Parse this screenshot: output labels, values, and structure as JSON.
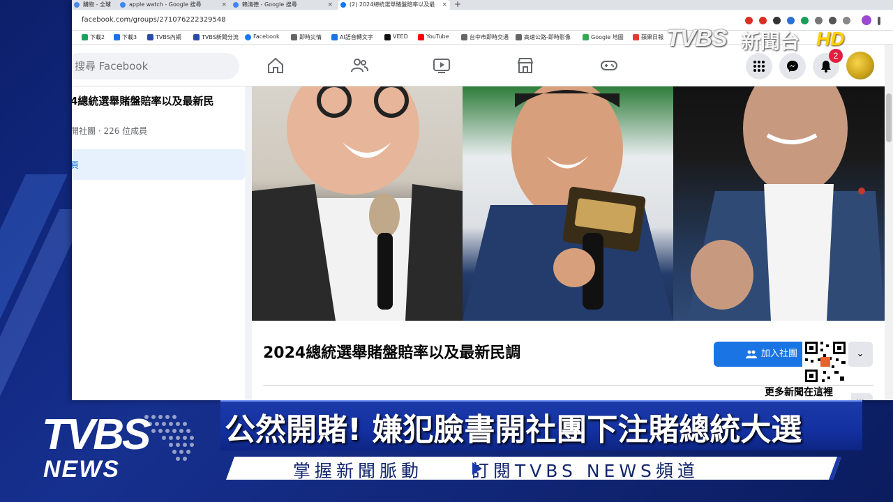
{
  "browser": {
    "tabs": [
      {
        "label": "購物 - 全球",
        "favicon_color": "#4a86e8"
      },
      {
        "label": "apple watch - Google 搜尋",
        "favicon_color": "#4285f4"
      },
      {
        "label": "賴清德 - Google 搜尋",
        "favicon_color": "#4285f4"
      },
      {
        "label": "(2) 2024總統選舉賭盤賠率以及最",
        "favicon_color": "#1877f2"
      }
    ],
    "url": "facebook.com/groups/271076222329548",
    "bookmarks": [
      {
        "label": "下載2",
        "color": "#19a35a"
      },
      {
        "label": "下載3",
        "color": "#1a73e8"
      },
      {
        "label": "TVBS內網",
        "color": "#2b4aa8"
      },
      {
        "label": "TVBS新聞分流",
        "color": "#2b4aa8"
      },
      {
        "label": "Facebook",
        "color": "#1877f2"
      },
      {
        "label": "即時災情",
        "color": "#666666"
      },
      {
        "label": "AI語音轉文字",
        "color": "#1a73e8"
      },
      {
        "label": "VEED",
        "color": "#111111"
      },
      {
        "label": "YouTube",
        "color": "#ff0000"
      },
      {
        "label": "台中市即時交通",
        "color": "#666666"
      },
      {
        "label": "高速公路-即時影像",
        "color": "#666666"
      },
      {
        "label": "Google 地圖",
        "color": "#34a853"
      },
      {
        "label": "蘋果日報",
        "color": "#e53935"
      }
    ]
  },
  "facebook": {
    "search_placeholder": "搜尋 Facebook",
    "notification_count": "2",
    "sidebar": {
      "group_title": "4總統選舉賭盤賠率以及最新民",
      "group_meta": "開社團 · 226 位成員",
      "active_item": "頁"
    },
    "group": {
      "title": "2024總統選舉賭盤賠率以及最新民調",
      "join_label": "加入社團",
      "dropdown_icon": "chevron-down-icon",
      "more_label": "…"
    }
  },
  "overlay": {
    "top_logo": "TVBS",
    "top_logo_cn": "新聞台",
    "top_hd": "HD",
    "qr_caption": "更多新聞在這裡",
    "headline": "公然開賭! 嫌犯臉書開社團下注賭總統大選",
    "sub_left": "掌握新聞脈動",
    "sub_right": "訂閱TVBS NEWS頻道",
    "bottom_logo_top": "TVBS",
    "bottom_logo_bottom": "NEWS"
  },
  "colors": {
    "facebook_blue": "#1b74e4",
    "broadcast_blue": "#1b3aa8",
    "hd_yellow": "#ffd200"
  }
}
